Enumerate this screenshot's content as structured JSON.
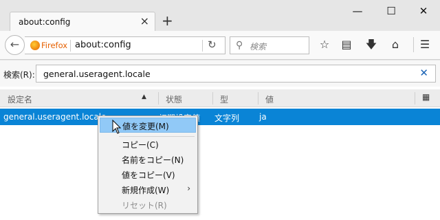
{
  "tab": {
    "title": "about:config",
    "close": "×",
    "newtab": "+"
  },
  "window": {
    "minimize": "—",
    "maximize": "☐",
    "close": "✕"
  },
  "nav": {
    "identity_label": "Firefox",
    "url": "about:config",
    "search_placeholder": "検索"
  },
  "content": {
    "search_label": "検索(R):",
    "filter_value": "general.useragent.locale",
    "columns": [
      "設定名",
      "状態",
      "型",
      "値"
    ],
    "row": {
      "name": "general.useragent.locale",
      "status": "初期設定値",
      "type": "文字列",
      "value": "ja"
    }
  },
  "context_menu": {
    "items": [
      {
        "label": "値を変更(M)"
      },
      {
        "label": "コピー(C)"
      },
      {
        "label": "名前をコピー(N)"
      },
      {
        "label": "値をコピー(V)"
      },
      {
        "label": "新規作成(W)"
      },
      {
        "label": "リセット(R)"
      }
    ]
  },
  "colors": {
    "selection": "#0a84d6",
    "menu_highlight": "#91c9f7",
    "firefox_orange": "#e66000",
    "clear_blue": "#1a63b5"
  },
  "icons": [
    "back-arrow-icon",
    "firefox-logo-icon",
    "reload-icon",
    "search-icon",
    "bookmark-star-icon",
    "library-icon",
    "download-icon",
    "home-icon",
    "menu-icon",
    "column-picker-icon",
    "clear-icon",
    "submenu-arrow-icon",
    "mouse-cursor-icon"
  ]
}
